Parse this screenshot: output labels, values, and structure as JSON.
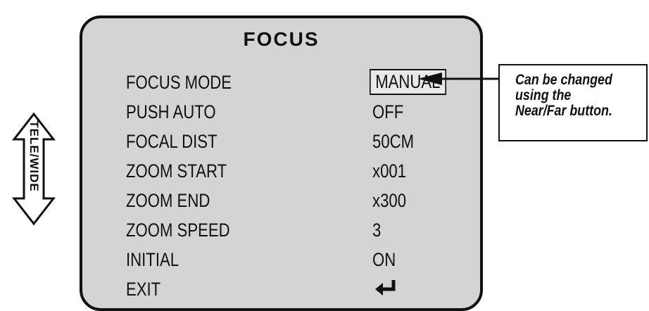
{
  "menu": {
    "title": "FOCUS",
    "items": [
      {
        "label": "FOCUS MODE",
        "value": "MANUAL"
      },
      {
        "label": "PUSH AUTO",
        "value": "OFF"
      },
      {
        "label": "FOCAL DIST",
        "value": "50CM"
      },
      {
        "label": "ZOOM START",
        "value": "x001"
      },
      {
        "label": "ZOOM END",
        "value": "x300"
      },
      {
        "label": "ZOOM SPEED",
        "value": "3"
      },
      {
        "label": "INITIAL",
        "value": "ON"
      },
      {
        "label": "EXIT",
        "value_icon": "enter-return-icon"
      }
    ]
  },
  "callout": {
    "text": "Can be changed\nusing the\nNear/Far button."
  },
  "side_control": {
    "label": "TELE/WIDE",
    "icon": "double-arrow-icon"
  }
}
